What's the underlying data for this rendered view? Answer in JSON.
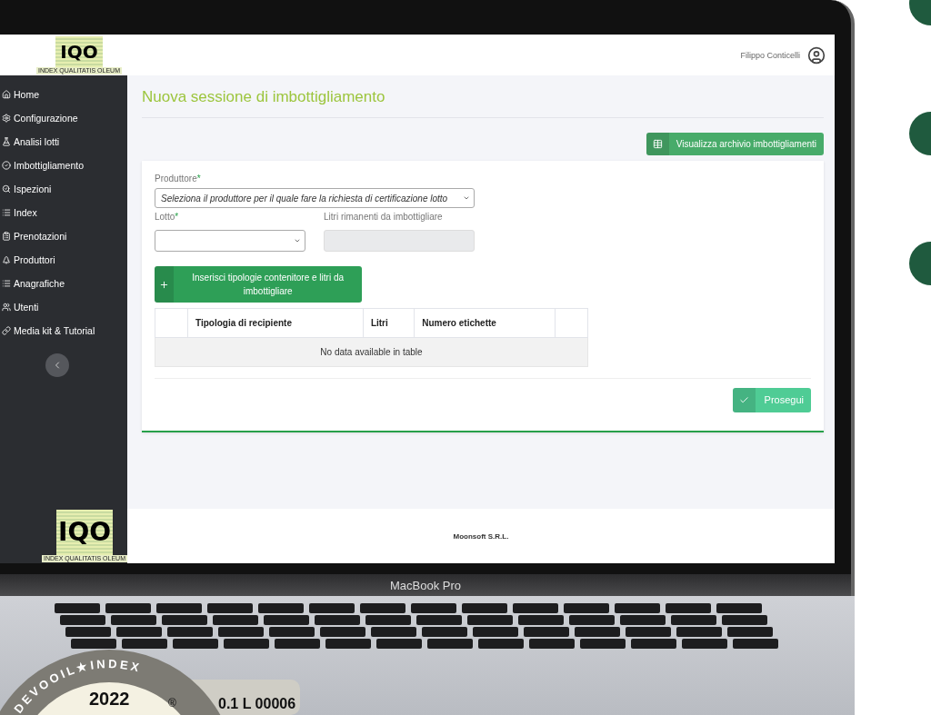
{
  "header": {
    "logo_text": "IQO",
    "logo_tagline": "INDEX QUALITATIS OLEUM",
    "user_name": "Filippo Conticelli"
  },
  "sidebar": {
    "items": [
      {
        "label": "Home"
      },
      {
        "label": "Configurazione"
      },
      {
        "label": "Analisi lotti"
      },
      {
        "label": "Imbottigliamento"
      },
      {
        "label": "Ispezioni"
      },
      {
        "label": "Index"
      },
      {
        "label": "Prenotazioni"
      },
      {
        "label": "Produttori"
      },
      {
        "label": "Anagrafiche"
      },
      {
        "label": "Utenti"
      },
      {
        "label": "Media kit & Tutorial"
      }
    ]
  },
  "page": {
    "title": "Nuova sessione di imbottigliamento",
    "archive_button": "Visualizza archivio imbottigliamenti",
    "producer": {
      "label": "Produttore",
      "required_mark": "*",
      "placeholder": "Seleziona il produttore per il quale fare la richiesta di certificazione lotto"
    },
    "lot": {
      "label": "Lotto",
      "required_mark": "*"
    },
    "remaining": {
      "label": "Litri rimanenti da imbottigliare",
      "disabled": true
    },
    "add_button": "Inserisci tipologie contenitore e litri da imbottigliare",
    "table": {
      "columns": [
        "Tipologia di recipiente",
        "Litri",
        "Numero etichette"
      ],
      "empty_message": "No data available in table"
    },
    "continue_button": "Prosegui"
  },
  "footer": {
    "logo_text": "IQO",
    "logo_tagline": "INDEX QUALITATIS OLEUM",
    "company": "Moonsoft S.R.L."
  },
  "device": {
    "model": "MacBook Pro"
  },
  "sticker": {
    "ring_text": "DEVOOIL★INDEX",
    "year": "2022",
    "mark": "®",
    "volume": "0.1 L",
    "serial": "00006"
  }
}
